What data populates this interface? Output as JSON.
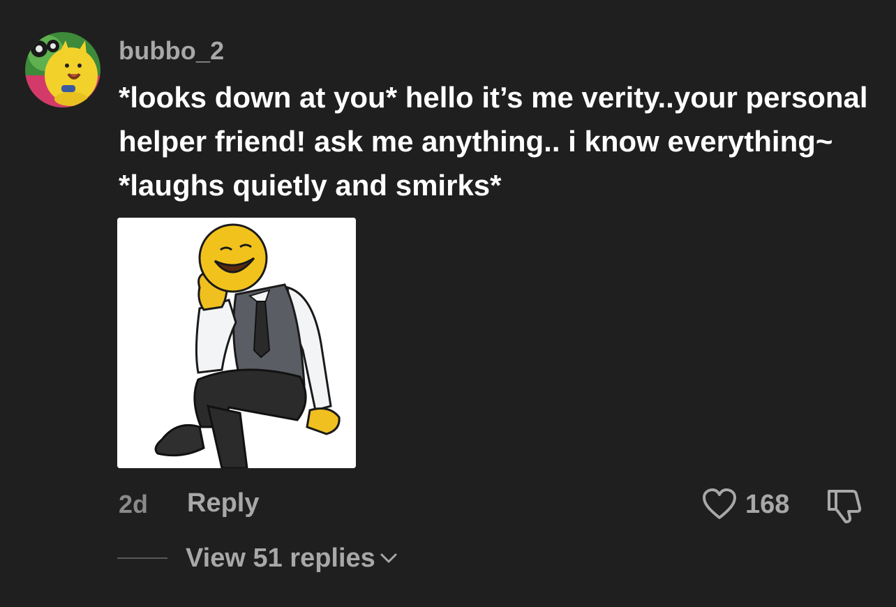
{
  "comment": {
    "username": "bubbo_2",
    "text": "*looks down at you* hello it’s me verity..your personal helper friend! ask me anything.. i know everything~ *laughs quietly and smirks*",
    "timestamp": "2d",
    "reply_label": "Reply",
    "like_count": "168",
    "view_replies_label": "View 51 replies",
    "avatar_icon": "yellow-cat-avatar",
    "image_icon": "smiling-emoji-man-in-vest-drawing",
    "like_icon": "heart-outline-icon",
    "dislike_icon": "thumbs-down-outline-icon",
    "chevron_icon": "chevron-down-icon"
  },
  "colors": {
    "background": "#1f1f1f",
    "primary_text": "#ffffff",
    "secondary_text": "#a8a8a8",
    "muted_text": "#8a8a8a"
  }
}
